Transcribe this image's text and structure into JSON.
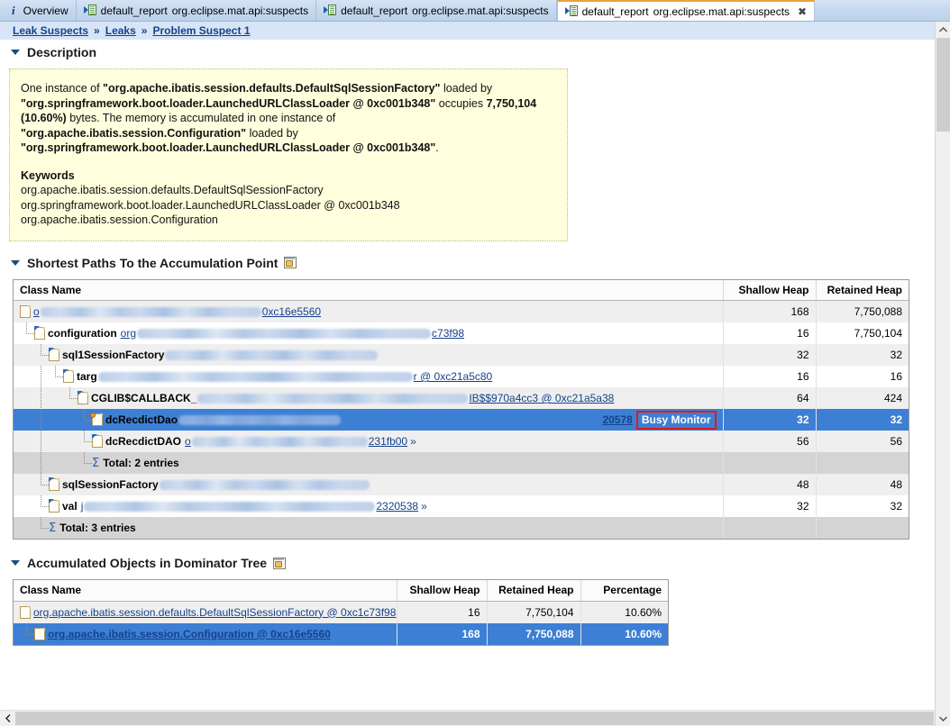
{
  "tabs": [
    {
      "icon": "info-icon",
      "label": "Overview",
      "type": "info",
      "active": false,
      "closable": false
    },
    {
      "icon": "report-icon",
      "label": "default_report",
      "sublabel": "org.eclipse.mat.api:suspects",
      "type": "report",
      "active": false,
      "closable": false
    },
    {
      "icon": "report-icon",
      "label": "default_report",
      "sublabel": "org.eclipse.mat.api:suspects",
      "type": "report",
      "active": false,
      "closable": false
    },
    {
      "icon": "report-icon",
      "label": "default_report",
      "sublabel": "org.eclipse.mat.api:suspects",
      "type": "report",
      "active": true,
      "closable": true
    }
  ],
  "breadcrumb": {
    "items": [
      {
        "label": "Leak Suspects"
      },
      {
        "label": "Leaks"
      },
      {
        "label": "Problem Suspect 1"
      }
    ],
    "separator": "»"
  },
  "sections": {
    "description": {
      "title": "Description",
      "expanded": true,
      "body_runs": [
        {
          "t": "One instance of ",
          "b": false
        },
        {
          "t": "\"org.apache.ibatis.session.defaults.DefaultSqlSessionFactory\"",
          "b": true
        },
        {
          "t": " loaded by ",
          "b": false
        },
        {
          "t": "\"org.springframework.boot.loader.LaunchedURLClassLoader @ 0xc001b348\"",
          "b": true
        },
        {
          "t": " occupies ",
          "b": false
        },
        {
          "t": "7,750,104 (10.60%)",
          "b": true
        },
        {
          "t": " bytes. The memory is accumulated in one instance of ",
          "b": false
        },
        {
          "t": "\"org.apache.ibatis.session.Configuration\"",
          "b": true
        },
        {
          "t": " loaded by ",
          "b": false
        },
        {
          "t": "\"org.springframework.boot.loader.LaunchedURLClassLoader @ 0xc001b348\"",
          "b": true
        },
        {
          "t": ".",
          "b": false
        }
      ],
      "keywords_title": "Keywords",
      "keywords": [
        "org.apache.ibatis.session.defaults.DefaultSqlSessionFactory",
        "org.springframework.boot.loader.LaunchedURLClassLoader @ 0xc001b348",
        "org.apache.ibatis.session.Configuration"
      ]
    },
    "shortest_paths": {
      "title": "Shortest Paths To the Accumulation Point",
      "expanded": true,
      "export_icon": "export-icon",
      "columns": [
        "Class Name",
        "Shallow Heap",
        "Retained Heap"
      ],
      "rows": [
        {
          "depth": 0,
          "icon": "file-icon",
          "name": "",
          "link": "0xc16e5560",
          "redacted": true,
          "shallow": "168",
          "retained": "7,750,088",
          "zebra": "alt",
          "sel": false,
          "kind": "node"
        },
        {
          "depth": 1,
          "icon": "file-ref-icon",
          "name": "configuration",
          "link": "org",
          "link2": "c73f98",
          "redacted": true,
          "shallow": "16",
          "retained": "7,750,104",
          "zebra": "white",
          "sel": false,
          "kind": "node"
        },
        {
          "depth": 2,
          "icon": "file-ref-icon",
          "name": "sql1SessionFactory",
          "link": "",
          "redacted": true,
          "shallow": "32",
          "retained": "32",
          "zebra": "alt",
          "sel": false,
          "kind": "node"
        },
        {
          "depth": 3,
          "icon": "file-ref-icon",
          "name": "targ",
          "link": "r @ 0xc21a5c80",
          "redacted": true,
          "shallow": "16",
          "retained": "16",
          "zebra": "white",
          "sel": false,
          "kind": "node"
        },
        {
          "depth": 4,
          "icon": "file-ref-icon",
          "name": "CGLIB$CALLBACK_",
          "link": "IB$$970a4cc3 @ 0xc21a5a38",
          "redacted": true,
          "shallow": "64",
          "retained": "424",
          "zebra": "alt",
          "sel": false,
          "kind": "node"
        },
        {
          "depth": 5,
          "icon": "file-dot-icon",
          "name": "dcRecdictDao",
          "link": "20578",
          "badge": "Busy Monitor",
          "redacted": true,
          "shallow": "32",
          "retained": "32",
          "zebra": "sel",
          "sel": true,
          "kind": "node"
        },
        {
          "depth": 5,
          "icon": "file-ref-icon",
          "name": "dcRecdictDAO",
          "link": "231fb00",
          "chevron": "»",
          "redacted": true,
          "shallow": "56",
          "retained": "56",
          "zebra": "alt",
          "sel": false,
          "kind": "node"
        },
        {
          "depth": 5,
          "icon": "sigma-icon",
          "name": "Total: 2 entries",
          "shallow": "",
          "retained": "",
          "zebra": "total",
          "sel": false,
          "kind": "total"
        },
        {
          "depth": 2,
          "icon": "file-ref-icon",
          "name": "sqlSessionFactory",
          "link": "",
          "redacted": true,
          "shallow": "48",
          "retained": "48",
          "zebra": "alt",
          "sel": false,
          "kind": "node"
        },
        {
          "depth": 2,
          "icon": "file-ref-icon",
          "name": "val",
          "link": "2320538",
          "chevron": "»",
          "redacted": true,
          "shallow": "32",
          "retained": "32",
          "zebra": "white",
          "sel": false,
          "kind": "node"
        },
        {
          "depth": 1,
          "icon": "sigma-icon",
          "name": "Total: 3 entries",
          "shallow": "",
          "retained": "",
          "zebra": "total",
          "sel": false,
          "kind": "total"
        }
      ]
    },
    "accumulated_objects": {
      "title": "Accumulated Objects in Dominator Tree",
      "expanded": true,
      "export_icon": "export-icon",
      "columns": [
        "Class Name",
        "Shallow Heap",
        "Retained Heap",
        "Percentage"
      ],
      "rows": [
        {
          "depth": 0,
          "icon": "file-icon",
          "link": "org.apache.ibatis.session.defaults.DefaultSqlSessionFactory @ 0xc1c73f98",
          "shallow": "16",
          "retained": "7,750,104",
          "percentage": "10.60%",
          "zebra": "alt",
          "sel": false
        },
        {
          "depth": 1,
          "icon": "file-icon",
          "link": "org.apache.ibatis.session.Configuration @ 0xc16e5560",
          "shallow": "168",
          "retained": "7,750,088",
          "percentage": "10.60%",
          "zebra": "white",
          "sel": true
        }
      ]
    }
  },
  "scrollbars": {
    "vertical": {
      "up": "▲",
      "down": "▼"
    },
    "horizontal": {
      "left": "❮"
    }
  },
  "colors": {
    "selection": "#3d7fd4",
    "link": "#15428b",
    "breadcrumb_bg": "#d7e5f7",
    "description_bg": "#ffffdd",
    "busy_monitor_border": "#e01b1b",
    "tab_active_top": "#e8a33d"
  }
}
